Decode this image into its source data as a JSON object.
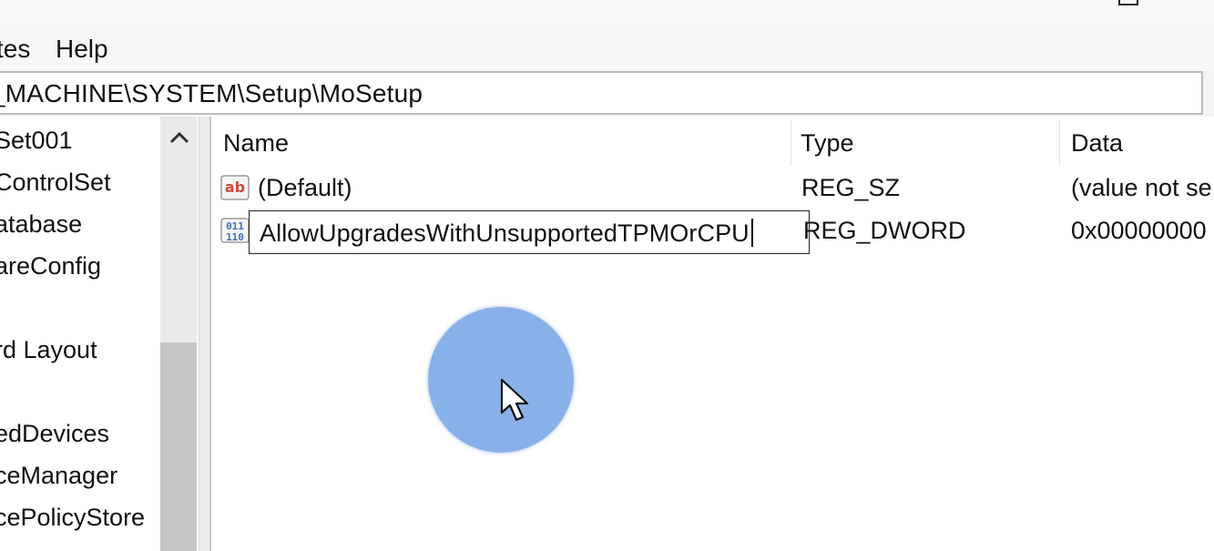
{
  "menu": {
    "items": [
      "tes",
      "Help"
    ]
  },
  "address": {
    "path": "_MACHINE\\SYSTEM\\Setup\\MoSetup"
  },
  "tree": {
    "items": [
      "Set001",
      "ControlSet",
      "atabase",
      "areConfig",
      "rd Layout",
      "edDevices",
      "ceManager",
      "cePolicyStore"
    ]
  },
  "values": {
    "columns": [
      "Name",
      "Type",
      "Data"
    ],
    "rows": [
      {
        "name": "(Default)",
        "type": "REG_SZ",
        "data": "(value not se",
        "icon": "string-value-icon"
      },
      {
        "name": "AllowUpgradesWithUnsupportedTPMOrCPU",
        "type": "REG_DWORD",
        "data": "0x00000000",
        "icon": "binary-value-icon"
      }
    ]
  },
  "colors": {
    "highlight": "#78a5e6",
    "border": "#bdbdbd",
    "icon_red": "#d0493c",
    "icon_blue": "#3f6fb5"
  }
}
